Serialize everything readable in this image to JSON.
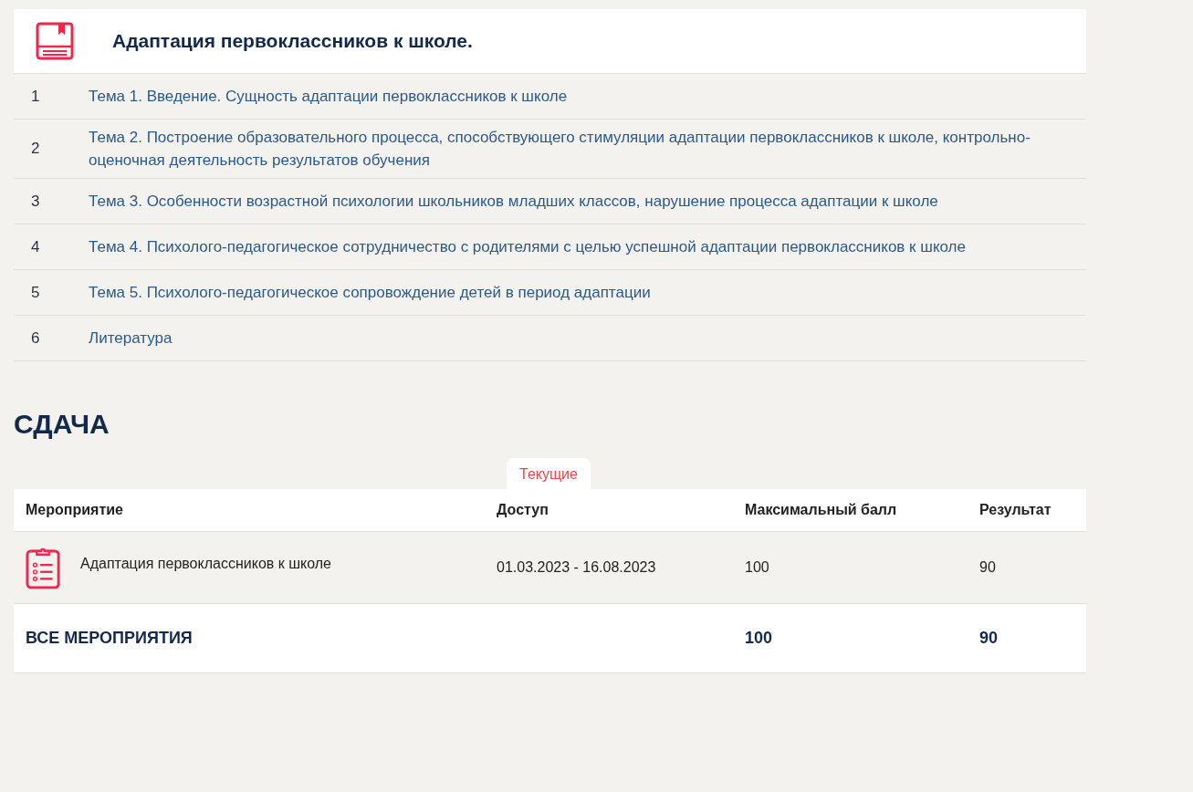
{
  "course": {
    "title": "Адаптация первоклассников к школе.",
    "topics": [
      {
        "number": "1",
        "title": "Тема 1. Введение. Сущность адаптации первоклассников к школе"
      },
      {
        "number": "2",
        "title": "Тема 2. Построение образовательного процесса, способствующего стимуляции адаптации первоклассников к школе, контрольно-оценочная деятельность результатов обучения"
      },
      {
        "number": "3",
        "title": "Тема 3. Особенности возрастной психологии школьников младших классов, нарушение процесса адаптации к школе"
      },
      {
        "number": "4",
        "title": "Тема 4. Психолого-педагогическое сотрудничество с родителями с целью успешной адаптации первоклассников к школе"
      },
      {
        "number": "5",
        "title": "Тема 5. Психолого-педагогическое сопровождение детей в период адаптации"
      },
      {
        "number": "6",
        "title": "Литература"
      }
    ]
  },
  "submission": {
    "heading": "СДАЧА",
    "tabs": [
      {
        "label": "Текущие",
        "selected": true
      }
    ],
    "table": {
      "columns": [
        "Мероприятие",
        "Доступ",
        "Максимальный балл",
        "Результат"
      ],
      "rows": [
        {
          "activity": "Адаптация первоклассников к школе",
          "access": "01.03.2023 - 16.08.2023",
          "max_score": "100",
          "result": "90"
        }
      ],
      "total": {
        "label": "ВСЕ МЕРОПРИЯТИЯ",
        "max_score": "100",
        "result": "90"
      }
    }
  }
}
